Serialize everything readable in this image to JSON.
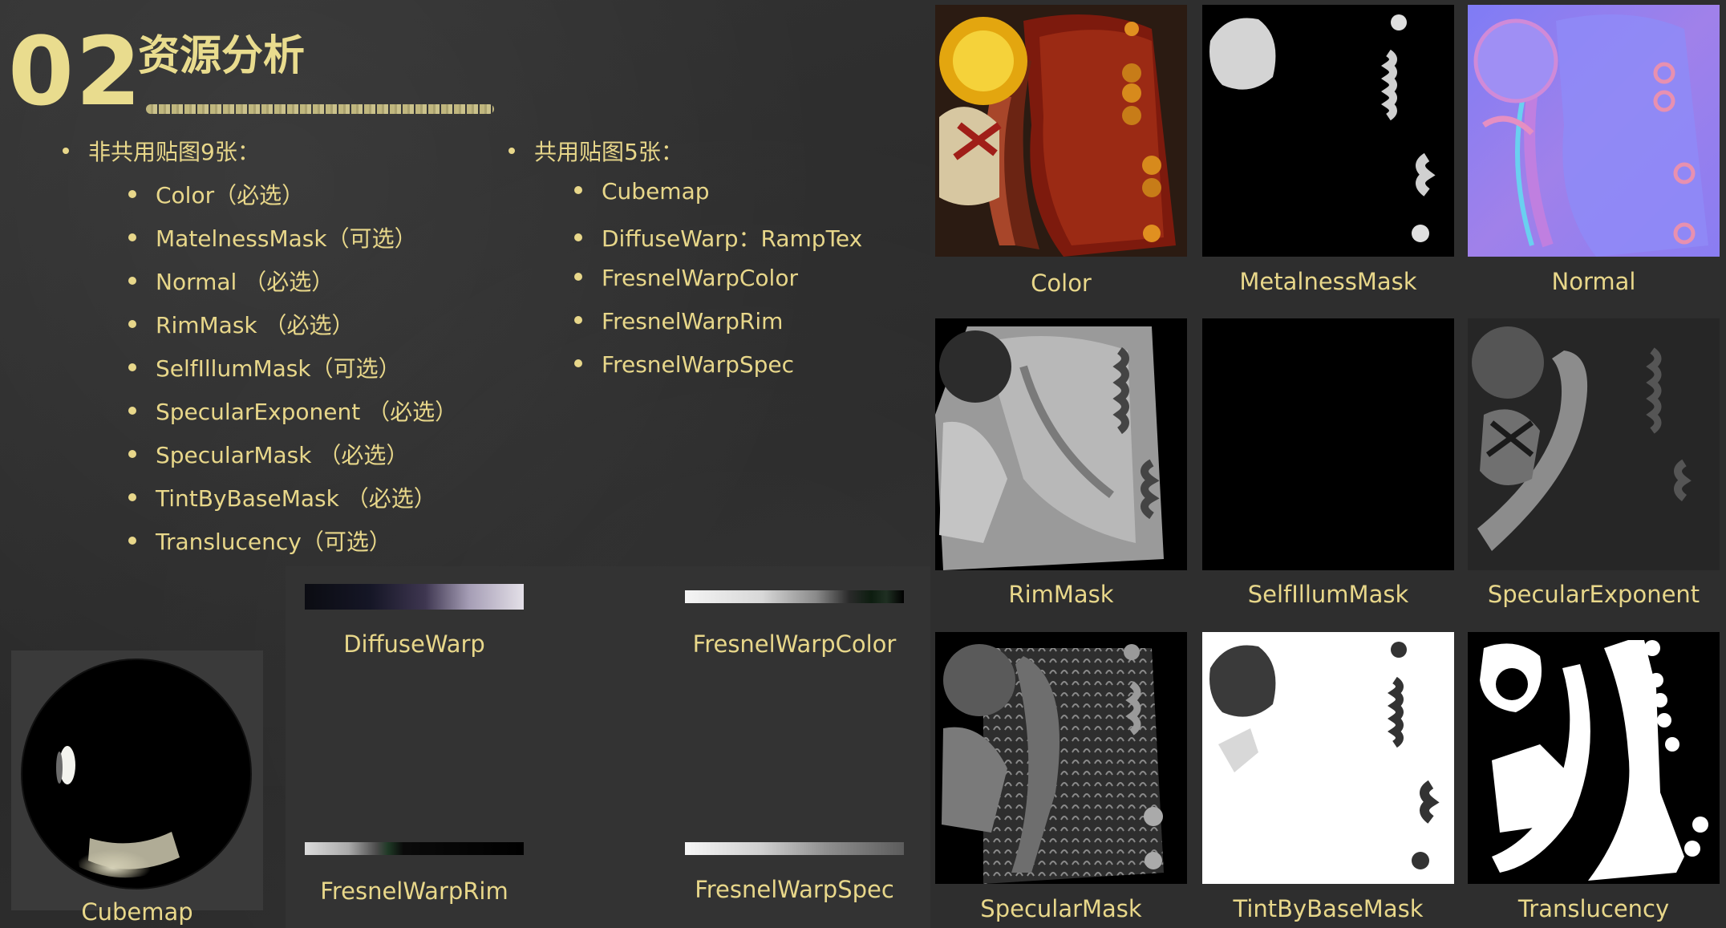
{
  "heading": {
    "number": "02",
    "title": "资源分析"
  },
  "left_list": {
    "title": "非共用贴图9张：",
    "items": [
      "Color（必选）",
      "MatelnessMask（可选）",
      "Normal （必选）",
      "RimMask （必选）",
      "SelfIllumMask（可选）",
      "SpecularExponent （必选）",
      "SpecularMask （必选）",
      "TintByBaseMask （必选）",
      "Translucency（可选）"
    ]
  },
  "right_list": {
    "title": "共用贴图5张：",
    "items": [
      "Cubemap",
      "DiffuseWarp：RampTex",
      "FresnelWarpColor",
      "FresnelWarpRim",
      "FresnelWarpSpec"
    ]
  },
  "shared_textures": {
    "diffuse_warp": "DiffuseWarp",
    "fresnel_warp_color": "FresnelWarpColor",
    "fresnel_warp_rim": "FresnelWarpRim",
    "fresnel_warp_spec": "FresnelWarpSpec",
    "cubemap": "Cubemap"
  },
  "texture_grid": [
    "Color",
    "MetalnessMask",
    "Normal",
    "RimMask",
    "SelfIllumMask",
    "SpecularExponent",
    "SpecularMask",
    "TintByBaseMask",
    "Translucency"
  ],
  "colors": {
    "chalk": "#e8d78a",
    "background": "#2e2e2e",
    "panel": "#333333"
  }
}
